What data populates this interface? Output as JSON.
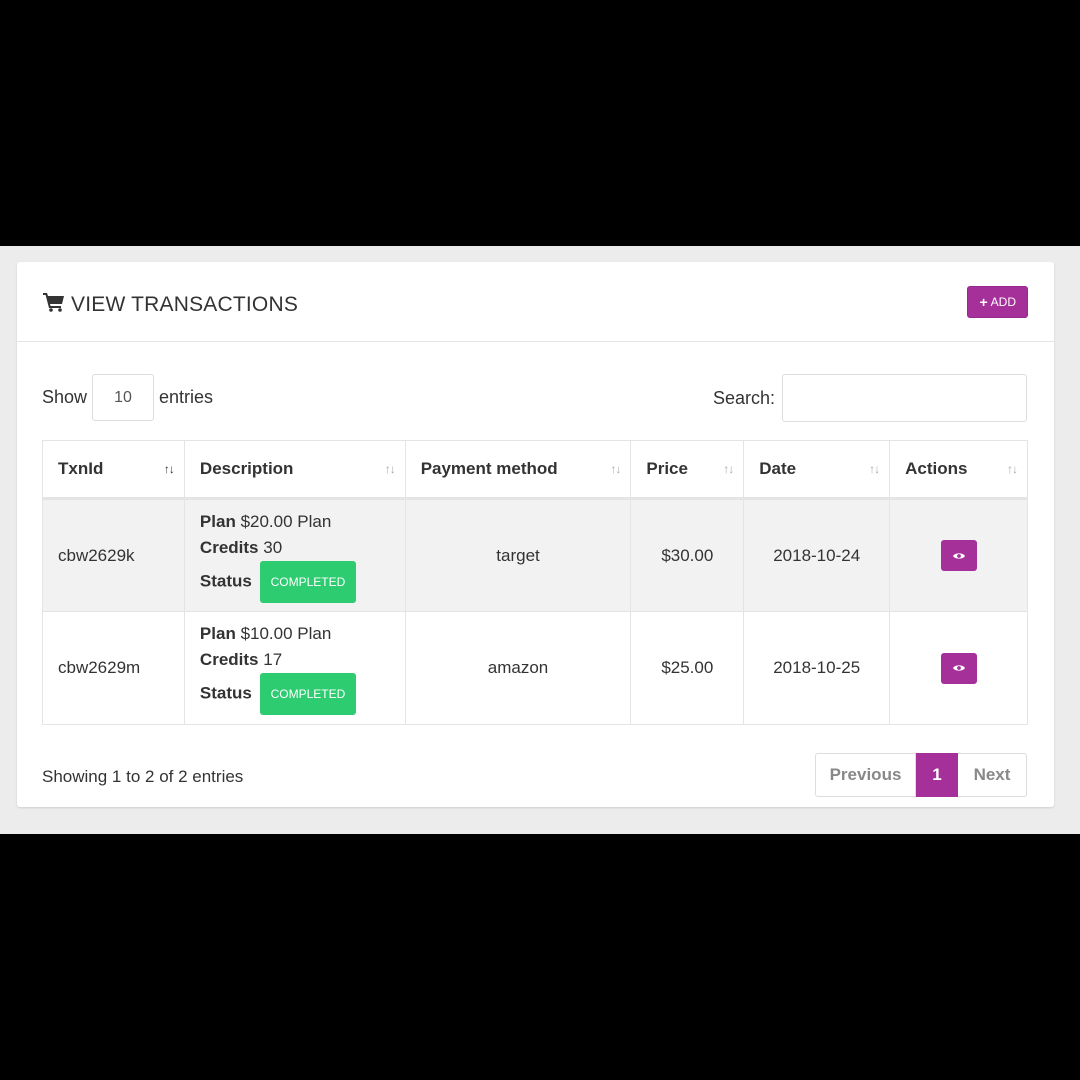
{
  "panel": {
    "title": "VIEW TRANSACTIONS",
    "title_icon": "shopping-cart-icon",
    "add_label": "ADD",
    "accent_color": "#a5309a"
  },
  "controls": {
    "show_label": "Show",
    "entries_value": "10",
    "entries_label": "entries",
    "search_label": "Search:",
    "search_value": ""
  },
  "table": {
    "columns": [
      "TxnId",
      "Description",
      "Payment method",
      "Price",
      "Date",
      "Actions"
    ],
    "rows": [
      {
        "txnid": "cbw2629k",
        "plan_label": "Plan",
        "plan_value": "$20.00 Plan",
        "credits_label": "Credits",
        "credits_value": "30",
        "status_label": "Status",
        "status_value": "COMPLETED",
        "payment_method": "target",
        "price": "$30.00",
        "date": "2018-10-24"
      },
      {
        "txnid": "cbw2629m",
        "plan_label": "Plan",
        "plan_value": "$10.00 Plan",
        "credits_label": "Credits",
        "credits_value": "17",
        "status_label": "Status",
        "status_value": "COMPLETED",
        "payment_method": "amazon",
        "price": "$25.00",
        "date": "2018-10-25"
      }
    ]
  },
  "footer": {
    "info": "Showing 1 to 2 of 2 entries",
    "previous": "Previous",
    "current_page": "1",
    "next": "Next"
  }
}
